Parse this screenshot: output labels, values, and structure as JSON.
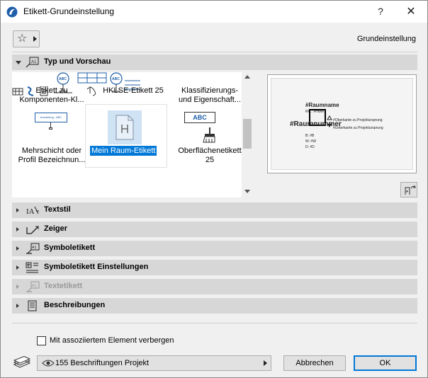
{
  "window": {
    "title": "Etikett-Grundeinstellung",
    "help_glyph": "?",
    "close_glyph": "✕"
  },
  "favorites": {
    "star_glyph": "☆",
    "preset_name": "Grundeinstellung"
  },
  "sections": {
    "type_preview": "Typ und Vorschau",
    "text_style": "Textstil",
    "pointer": "Zeiger",
    "symbol_label": "Symboletikett",
    "symbol_label_settings": "Symboletikett Einstellungen",
    "text_label": "Textetikett",
    "descriptions": "Beschreibungen"
  },
  "gallery": {
    "items": [
      {
        "line1": "Etikett zu",
        "line2": "Komponenten-Kl..."
      },
      {
        "line1": "HKLSE-Etikett 25",
        "line2": ""
      },
      {
        "line1": "Klassifizierungs-",
        "line2": "und Eigenschaft..."
      },
      {
        "line1": "Mehrschicht oder",
        "line2": "Profil Bezeichnun..."
      },
      {
        "line1": "Mein Raum-Etikett",
        "line2": ""
      },
      {
        "line1": "Oberflächenetikett",
        "line2": "25"
      }
    ],
    "icon_texts": {
      "abc": "ABC",
      "layer_tag": "Anzahlung - ABC"
    }
  },
  "preview": {
    "room_name": "#Raumname",
    "room_number": "#Raumnummer",
    "rh": "RH.: #Höhe",
    "ok_ref": "#Oberkante zu Projektursprung",
    "uk_ref": "#Unterkante zu Projektursprung",
    "b": "B: #B",
    "w": "W: #W",
    "d": "D: #D"
  },
  "options": {
    "hide_with_element": "Mit assoziiertem Element verbergen"
  },
  "footer": {
    "layer_value": "155 Beschriftungen Projekt",
    "cancel": "Abbrechen",
    "ok": "OK"
  },
  "colors": {
    "selection": "#0078d7",
    "section_bg": "#d7d7d7",
    "icon_blue": "#1f5fa8"
  }
}
